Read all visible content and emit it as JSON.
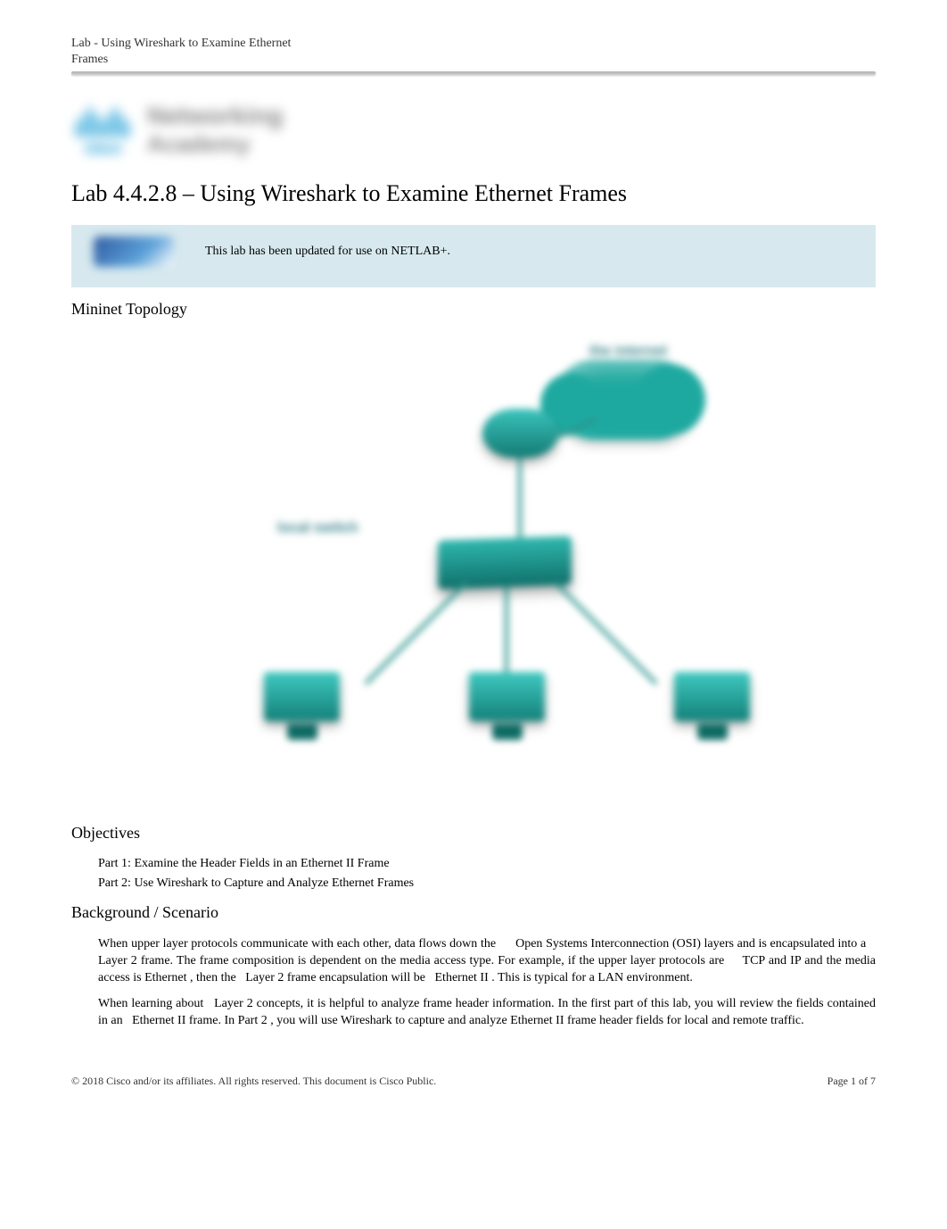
{
  "header": {
    "doc_label_line1": "Lab - Using Wireshark to Examine Ethernet",
    "doc_label_line2": "Frames"
  },
  "logo": {
    "line1": "Networking",
    "line2": "Academy",
    "brand": "cisco"
  },
  "title": "Lab 4.4.2.8 – Using Wireshark to Examine Ethernet Frames",
  "netlab_notice": "This lab has been updated for use on NETLAB+.",
  "sections": {
    "topology_heading": "Mininet Topology",
    "objectives_heading": "Objectives",
    "background_heading": "Background / Scenario"
  },
  "topology_labels": {
    "cloud": "the internet",
    "switch": "local switch"
  },
  "objectives": {
    "part1": "Part 1: Examine the Header Fields in an Ethernet II Frame",
    "part2": "Part 2: Use Wireshark to Capture and Analyze Ethernet Frames"
  },
  "background": {
    "p1_a": "When upper layer protocols communicate with each other, data flows down the ",
    "p1_osi_full": "Open Systems Interconnection",
    "p1_b": " (",
    "p1_osi": "OSI",
    "p1_c": ") layers and is encapsulated into a ",
    "p1_layer2_1": "Layer 2",
    "p1_d": " frame. The frame composition is dependent on the media access type. For example, if the upper layer protocols are ",
    "p1_tcp": "TCP",
    "p1_and1": " and ",
    "p1_ip": "IP",
    "p1_e": " and the media access is ",
    "p1_eth": "Ethernet",
    "p1_f": ", then the ",
    "p1_layer2_2": "Layer 2",
    "p1_g": " frame encapsulation will be ",
    "p1_ethii": "Ethernet II",
    "p1_h": ". This is typical for a LAN environment.",
    "p2_a": "When learning about ",
    "p2_layer2": "Layer 2",
    "p2_b": " concepts, it is helpful to analyze frame header information. In the first part of this lab, you will review the fields contained in an ",
    "p2_ethii": "Ethernet II",
    "p2_c": " frame. In ",
    "p2_part2": "Part 2",
    "p2_d": ", you will use ",
    "p2_wireshark": "Wireshark",
    "p2_e": " to capture and analyze ",
    "p2_ethii2": "Ethernet II",
    "p2_f": " frame header fields for local and remote traffic."
  },
  "footer": {
    "copyright": "© 2018 Cisco and/or its affiliates. All rights reserved. This document is Cisco Public.",
    "page": "Page 1  of 7"
  }
}
